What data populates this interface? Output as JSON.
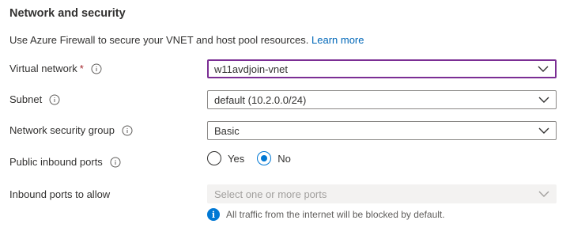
{
  "section": {
    "title": "Network and security",
    "description": "Use Azure Firewall to secure your VNET and host pool resources.",
    "learn_more": "Learn more"
  },
  "fields": {
    "virtual_network": {
      "label": "Virtual network",
      "required_mark": "*",
      "value": "w11avdjoin-vnet",
      "icon": "info-icon"
    },
    "subnet": {
      "label": "Subnet",
      "value": "default (10.2.0.0/24)",
      "icon": "info-icon"
    },
    "nsg": {
      "label": "Network security group",
      "value": "Basic",
      "icon": "info-icon"
    },
    "public_inbound": {
      "label": "Public inbound ports",
      "options": [
        "Yes",
        "No"
      ],
      "selected": "No",
      "icon": "info-icon"
    },
    "inbound_ports": {
      "label": "Inbound ports to allow",
      "placeholder": "Select one or more ports",
      "disabled": true
    },
    "note": "All traffic from the internet will be blocked by default."
  },
  "colors": {
    "accent": "#0078d4",
    "focus_border": "#7b2e94",
    "required": "#a4262c",
    "link": "#0067b8"
  }
}
